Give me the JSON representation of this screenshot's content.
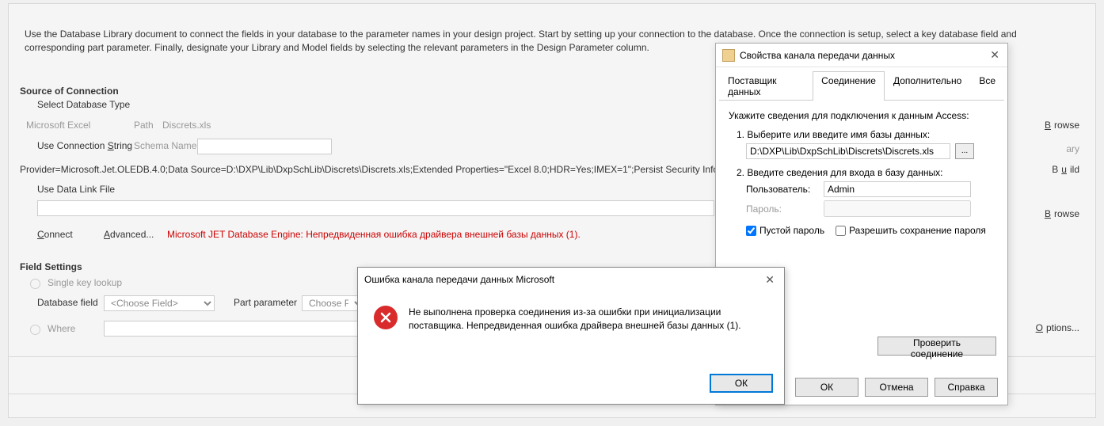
{
  "intro": "Use the Database Library document to connect the fields in your database to the parameter names in your design project. Start by setting up your connection to the database. Once the connection is setup, select a key database field and corresponding part parameter. Finally, designate your Library and Model fields by selecting the relevant parameters in the Design Parameter column.",
  "sections": {
    "source_of_connection": "Source of Connection",
    "select_db_type": "Select Database Type",
    "ms_excel": "Microsoft Excel",
    "path_label": "Path",
    "path_value": "Discrets.xls",
    "use_conn_string_pre": "Use Connection ",
    "use_conn_string_u": "S",
    "use_conn_string_post": "tring",
    "schema_name": "Schema Name",
    "conn_string": "Provider=Microsoft.Jet.OLEDB.4.0;Data Source=D:\\DXP\\Lib\\DxpSchLib\\Discrets\\Discrets.xls;Extended Properties=\"Excel 8.0;HDR=Yes;IMEX=1\";Persist Security Info=False",
    "use_data_link": "Use Data Link File",
    "connect_u": "C",
    "connect_post": "onnect",
    "advanced_u": "A",
    "advanced_post": "dvanced...",
    "jet_error": "Microsoft JET Database Engine: Непредвиденная ошибка драйвера внешней базы данных (1).",
    "field_settings": "Field Settings",
    "single_key": "Single key lookup",
    "database_field": "Database field",
    "choose_field": "<Choose Field>",
    "part_parameter": "Part parameter",
    "choose_parameter": "Choose Parameter",
    "where": "Where",
    "browse_u": "B",
    "browse_post": "rowse",
    "ary": "ary",
    "build_pre": "B",
    "build_u": "u",
    "build_post": "ild",
    "options_u": "O",
    "options_post": "ptions..."
  },
  "err_dialog": {
    "title": "Ошибка канала передачи данных Microsoft",
    "message": "Не выполнена проверка соединения из-за ошибки при инициализации поставщика. Непредвиденная ошибка драйвера внешней базы данных (1).",
    "ok": "ОК"
  },
  "props_dialog": {
    "title": "Свойства канала передачи данных",
    "tabs": {
      "provider": "Поставщик данных",
      "connection": "Соединение",
      "additional": "Дополнительно",
      "all": "Все"
    },
    "instruction": "Укажите сведения для подключения к данным Access:",
    "step1": "1. Выберите или введите имя базы данных:",
    "db_path": "D:\\DXP\\Lib\\DxpSchLib\\Discrets\\Discrets.xls",
    "browse_dots": "...",
    "step2": "2. Введите сведения для входа в базу данных:",
    "user_label": "Пользователь:",
    "user_value": "Admin",
    "password_label": "Пароль:",
    "blank_password": "Пустой пароль",
    "allow_save": "Разрешить сохранение пароля",
    "test_conn": "Проверить соединение",
    "ok": "ОК",
    "cancel": "Отмена",
    "help": "Справка"
  }
}
